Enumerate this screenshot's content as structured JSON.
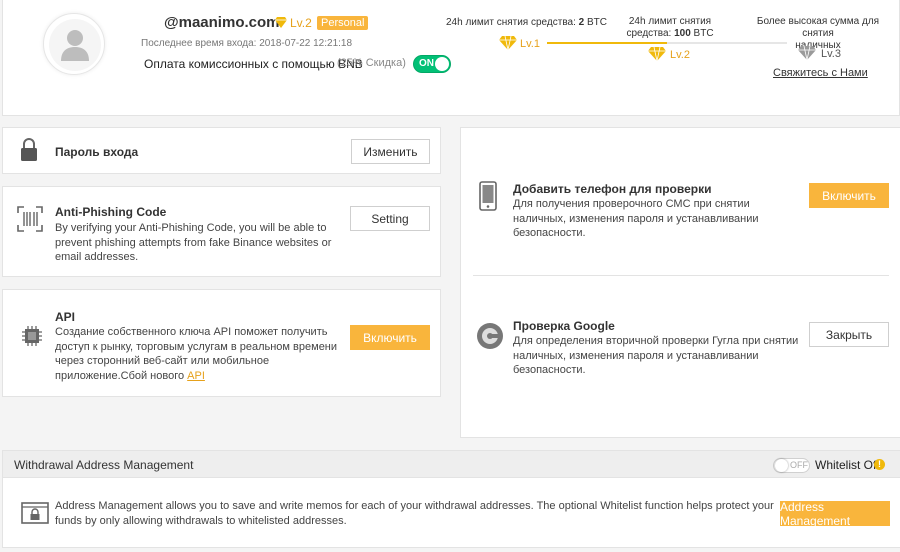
{
  "profile": {
    "email": "@maanimo.com",
    "level": "Lv.2",
    "account_type": "Personal",
    "last_login_label": "Последнее время входа:",
    "last_login_time": "2018-07-22 12:21:18",
    "bnb_fee_label": "Оплата комиссионных с помощью BNB",
    "bnb_discount": "(25% Скидка)",
    "bnb_toggle": "ON"
  },
  "limits": {
    "lv1_label_prefix": "24h лимит снятия средства:",
    "lv1_amount": "2",
    "lv1_unit": "BTC",
    "lv1_name": "Lv.1",
    "lv2_label_line1": "24h лимит снятия",
    "lv2_label_prefix": "средства:",
    "lv2_amount": "100",
    "lv2_unit": "BTC",
    "lv2_name": "Lv.2",
    "lv3_label_line1": "Более высокая сумма для снятия",
    "lv3_label_line2": "наличных",
    "lv3_name": "Lv.3",
    "contact_link": "Свяжитесь с Нами",
    "progress_fraction": 0.5
  },
  "login_password": {
    "title": "Пароль входа",
    "button": "Изменить"
  },
  "anti_phishing": {
    "title": "Anti-Phishing Code",
    "desc_line1": "By verifying your Anti-Phishing Code, you will be able to",
    "desc_line2": "prevent phishing attempts from fake Binance websites or",
    "desc_line3": "email addresses.",
    "button": "Setting"
  },
  "api": {
    "title": "API",
    "desc_line1": "Создание собственного ключа API поможет получить",
    "desc_line2": "доступ к рынку, торговым услугам в реальном времени",
    "desc_line3": "через сторонний веб-сайт или мобильное",
    "desc_line4": "приложение.Сбой нового ",
    "desc_link": "API",
    "button": "Включить"
  },
  "phone": {
    "title": "Добавить телефон для проверки",
    "desc_line1": "Для получения проверочного СМС при снятии",
    "desc_line2": "наличных, изменения пароля и устанавливании",
    "desc_line3": "безопасности.",
    "button": "Включить"
  },
  "google": {
    "title": "Проверка Google",
    "desc_line1": "Для определения вторичной проверки Гугла при снятии",
    "desc_line2": "наличных, изменения пароля и устанавливании",
    "desc_line3": "безопасности.",
    "button": "Закрыть"
  },
  "withdrawal": {
    "header": "Withdrawal Address Management",
    "toggle": "OFF",
    "whitelist_label": "Whitelist Off",
    "desc_line1": "Address Management allows you to save and write memos for each of your withdrawal addresses. The optional Whitelist function helps protect your",
    "desc_line2": "funds by only allowing withdrawals to whitelisted addresses.",
    "button": "Address Management"
  },
  "colors": {
    "accent": "#f9b53c",
    "gold": "#e6a11b",
    "toggle_on": "#02c076",
    "border": "#e3e3e3"
  }
}
